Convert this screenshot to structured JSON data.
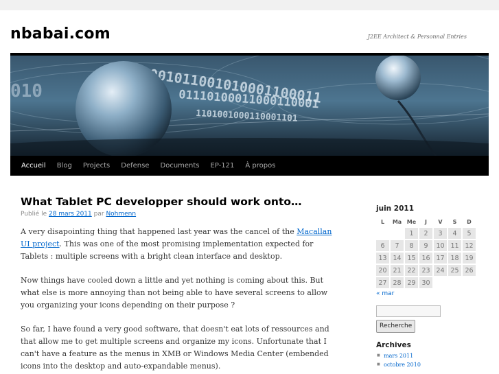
{
  "site": {
    "title": "nbabai.com",
    "description": "J2EE Architect & Personnal Entries"
  },
  "banner": {
    "binary_text": [
      "1001011001010001100011",
      "01110100011000110001",
      "1101001000110001101"
    ],
    "colors": {
      "sky": "#4d7590",
      "dark": "#14222e"
    }
  },
  "nav": {
    "items": [
      {
        "label": "Accueil"
      },
      {
        "label": "Blog"
      },
      {
        "label": "Projects"
      },
      {
        "label": "Defense"
      },
      {
        "label": "Documents"
      },
      {
        "label": "EP-121"
      },
      {
        "label": "À propos"
      }
    ]
  },
  "post": {
    "title": "What Tablet PC developper should work onto…",
    "meta_prefix": "Publié le",
    "date": "28 mars 2011",
    "by": "par",
    "author": "Nohmenn",
    "p1_before": "A very disapointing thing that happened last year was the cancel of the ",
    "p1_link": "Macallan UI project",
    "p1_after": ". This was one of the most promising implementation expected for Tablets : multiple screens with a bright clean interface and desktop.",
    "p2": "Now things have cooled down a little and yet nothing is coming about this. But what else is more annoying than not being able to have several screens to allow you organizing your icons depending on their purpose ?",
    "p3": "So far, I have found a very good software, that doesn't eat lots of ressources and that allow me to get multiple screens and organize my icons. Unfortunate that I can't have a feature as the menus in XMB or Windows Media Center (embended icons into the desktop and auto-expandable menus)."
  },
  "calendar": {
    "caption": "juin 2011",
    "days": [
      "L",
      "Ma",
      "Me",
      "J",
      "V",
      "S",
      "D"
    ],
    "rows": [
      [
        "",
        "",
        "1",
        "2",
        "3",
        "4",
        "5"
      ],
      [
        "6",
        "7",
        "8",
        "9",
        "10",
        "11",
        "12"
      ],
      [
        "13",
        "14",
        "15",
        "16",
        "17",
        "18",
        "19"
      ],
      [
        "20",
        "21",
        "22",
        "23",
        "24",
        "25",
        "26"
      ],
      [
        "27",
        "28",
        "29",
        "30",
        "",
        "",
        ""
      ]
    ],
    "prev": "« mar"
  },
  "search": {
    "button": "Recherche"
  },
  "archives": {
    "title": "Archives",
    "items": [
      {
        "label": "mars 2011"
      },
      {
        "label": "octobre 2010"
      }
    ]
  },
  "colors": {
    "link": "#0066cc",
    "nav_bg": "#000000",
    "page_bg": "#f1f1f1"
  }
}
